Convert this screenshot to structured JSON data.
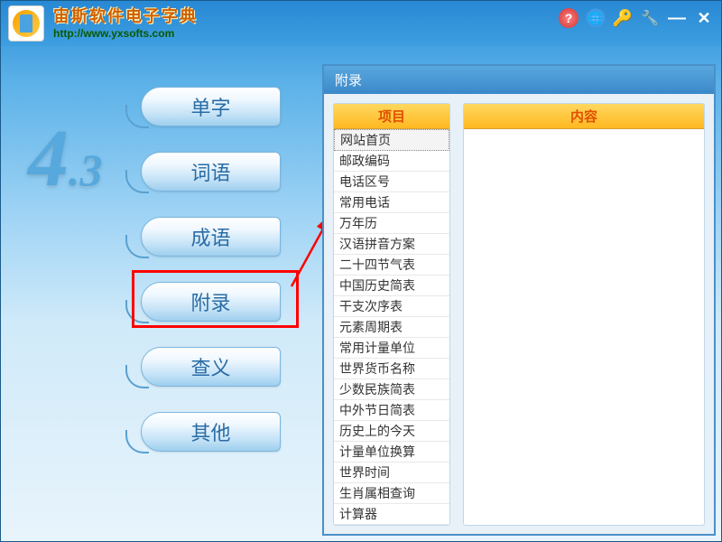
{
  "app": {
    "title": "宙斯软件电子字典",
    "url": "http://www.yxsofts.com",
    "version_main": "4",
    "version_sub": ".3"
  },
  "nav": {
    "tabs": [
      "单字",
      "词语",
      "成语",
      "附录",
      "查义",
      "其他"
    ]
  },
  "panel": {
    "title": "附录",
    "col_project": "项目",
    "col_content": "内容",
    "items": [
      "网站首页",
      "邮政编码",
      "电话区号",
      "常用电话",
      "万年历",
      "汉语拼音方案",
      "二十四节气表",
      "中国历史简表",
      "干支次序表",
      "元素周期表",
      "常用计量单位",
      "世界货币名称",
      "少数民族简表",
      "中外节日简表",
      "历史上的今天",
      "计量单位换算",
      "世界时间",
      "生肖属相查询",
      "计算器"
    ]
  }
}
